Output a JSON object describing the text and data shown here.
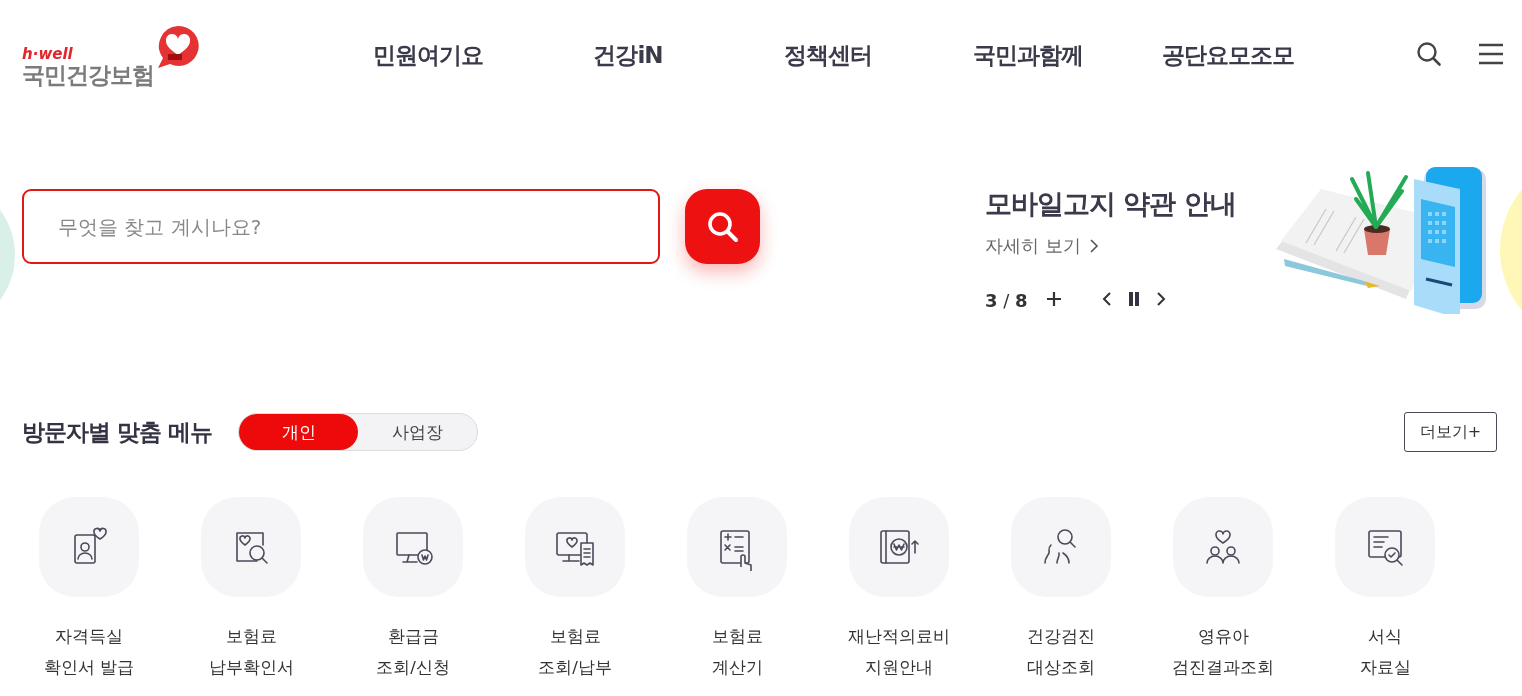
{
  "logo": {
    "tagline": "h·well",
    "name": "국민건강보험"
  },
  "nav": [
    {
      "label": "민원여기요"
    },
    {
      "label": "건강iN"
    },
    {
      "label": "정책센터"
    },
    {
      "label": "국민과함께"
    },
    {
      "label": "공단요모조모"
    }
  ],
  "search": {
    "placeholder": "무엇을 찾고 계시나요?"
  },
  "banner": {
    "title": "모바일고지 약관 안내",
    "link": "자세히 보기",
    "counter": "**3** / **8**"
  },
  "visitor_menu": {
    "title": "방문자별 맞춤 메뉴",
    "tabs": [
      {
        "label": "개인",
        "selected": true
      },
      {
        "label": "사업장",
        "selected": false
      }
    ],
    "more_button": "더보기+",
    "items": [
      {
        "lines": [
          "자격득실",
          "확인서 발급"
        ]
      },
      {
        "lines": [
          "보험료",
          "납부확인서"
        ]
      },
      {
        "lines": [
          "환급금",
          "조회/신청"
        ]
      },
      {
        "lines": [
          "보험료",
          "조회/납부"
        ]
      },
      {
        "lines": [
          "보험료",
          "계산기"
        ]
      },
      {
        "lines": [
          "재난적의료비",
          "지원안내"
        ]
      },
      {
        "lines": [
          "건강검진",
          "대상조회"
        ]
      },
      {
        "lines": [
          "영유아",
          "검진결과조회"
        ]
      },
      {
        "lines": [
          "서식",
          "자료실"
        ]
      }
    ]
  }
}
